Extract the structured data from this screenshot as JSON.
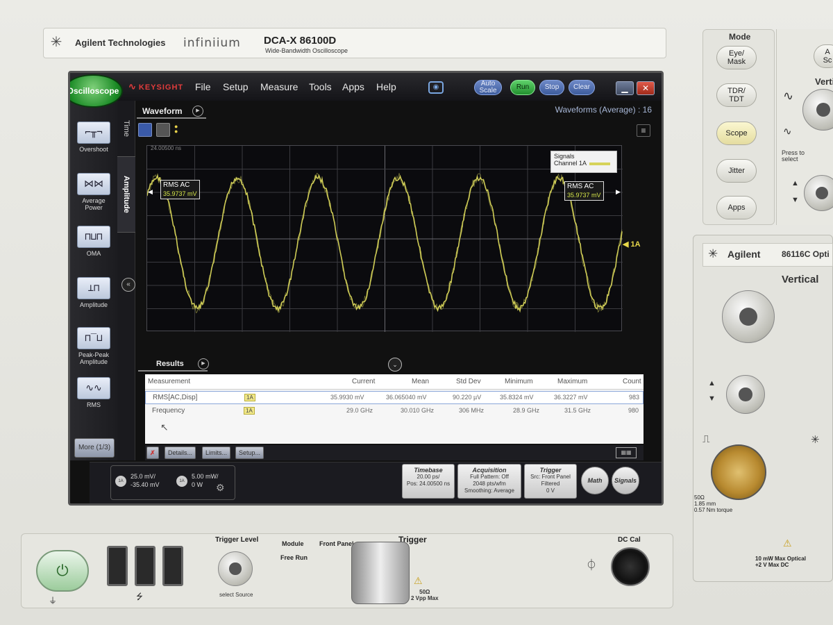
{
  "bezel": {
    "brand": "Agilent Technologies",
    "series": "infiniium",
    "model": "DCA-X  86100D",
    "model_subtitle": "Wide-Bandwidth Oscilloscope"
  },
  "mode_panel": {
    "title": "Mode",
    "buttons": [
      "Eye/\nMask",
      "TDR/\nTDT",
      "Scope",
      "Jitter",
      "Apps"
    ],
    "press_to_select": "Press to\nselect",
    "right_edge_label": "Verti",
    "right_edge_btn": "A\nSc"
  },
  "module": {
    "brand": "Agilent",
    "model": "86116C Opti",
    "section": "Vertical",
    "spec": "50Ω\n1.85 mm\n0.57 Nm torque",
    "optical_spec": "10 mW Max Optical\n+2 V Max DC"
  },
  "bottom_panel": {
    "trigger_level": "Trigger Level",
    "module": "Module",
    "front_panel": "Front Panel",
    "trigger": "Trigger",
    "free_run": "Free Run",
    "select_source": "select Source",
    "dc_cal": "DC Cal",
    "trigger_spec": "50Ω\n2 Vpp Max"
  },
  "screen": {
    "app_badge": "Oscilloscope",
    "logo": "KEYSIGHT",
    "menu": [
      "File",
      "Setup",
      "Measure",
      "Tools",
      "Apps",
      "Help"
    ],
    "buttons": {
      "auto_scale": "Auto\nScale",
      "run": "Run",
      "stop": "Stop",
      "clear": "Clear"
    },
    "window": {
      "minimize": "▁",
      "close": "✕"
    },
    "vtabs": {
      "time": "Time",
      "amplitude": "Amplitude"
    },
    "measurements": [
      {
        "label": "Overshoot",
        "icon": "⌐╥¬"
      },
      {
        "label": "Average Power",
        "icon": "⋈⋈"
      },
      {
        "label": "OMA",
        "icon": "⊓⊔⊓"
      },
      {
        "label": "Amplitude",
        "icon": "⊥⊓"
      },
      {
        "label": "Peak-Peak\nAmplitude",
        "icon": "⊓‾⊔"
      },
      {
        "label": "RMS",
        "icon": "∿∿"
      }
    ],
    "more": "More (1/3)",
    "waveform_tab": "Waveform",
    "waveform_count": "Waveforms (Average) : 16",
    "timestamp": "24.00500 ns",
    "rms_left": {
      "label": "RMS AC",
      "value": "35.9737 mV"
    },
    "rms_right": {
      "label": "RMS AC",
      "value": "35.9737 mV"
    },
    "signals_legend": {
      "title": "Signals",
      "channel": "Channel 1A"
    },
    "channel_marker": "◀ 1A",
    "results_tab": "Results",
    "table": {
      "headers": [
        "Measurement",
        "Current",
        "Mean",
        "Std Dev",
        "Minimum",
        "Maximum",
        "Count"
      ],
      "rows": [
        [
          "RMS[AC,Disp]",
          "1A",
          "35.9930 mV",
          "36.065040 mV",
          "90.220 µV",
          "35.8324 mV",
          "36.3227 mV",
          "983"
        ],
        [
          "Frequency",
          "1A",
          "29.0 GHz",
          "30.010 GHz",
          "306 MHz",
          "28.9 GHz",
          "31.5 GHz",
          "980"
        ]
      ]
    },
    "result_buttons": [
      "✗",
      "Details...",
      "Limits...",
      "Setup..."
    ],
    "status": {
      "ch1": {
        "chip": "1A",
        "line1": "25.0 mV/",
        "line2": "-35.40 mV"
      },
      "ch2": {
        "chip": "1A",
        "line1": "5.00 mW/",
        "line2": "0 W"
      },
      "timebase": {
        "title": "Timebase",
        "line1": "20.00 ps/",
        "line2": "Pos: 24.00500 ns"
      },
      "acquisition": {
        "title": "Acquisition",
        "line1": "Full Pattern: Off",
        "line2": "2048 pts/wfm",
        "line3": "Smoothing: Average"
      },
      "trigger": {
        "title": "Trigger",
        "line1": "Src: Front Panel",
        "line2": "Filtered",
        "line3": "0 V"
      },
      "math": "Math",
      "signals": "Signals"
    }
  },
  "colors": {
    "trace": "#d6d35a",
    "accent_blue": "#4a6ab0",
    "run_green": "#2fa83c",
    "badge_green": "#1a8a25"
  }
}
